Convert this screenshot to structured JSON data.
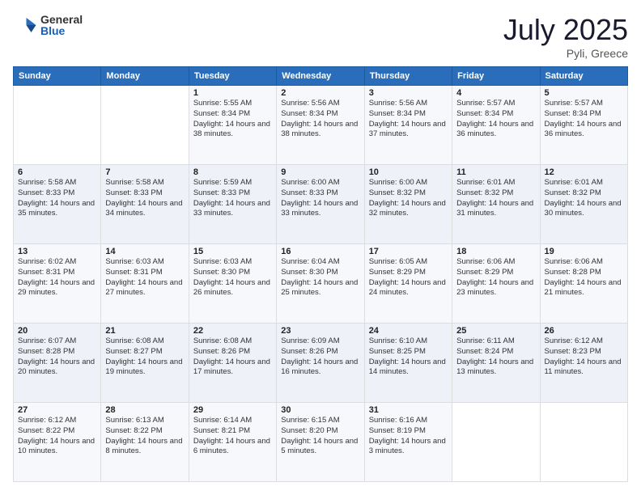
{
  "header": {
    "logo_general": "General",
    "logo_blue": "Blue",
    "title": "July 2025",
    "location": "Pyli, Greece"
  },
  "calendar": {
    "days_header": [
      "Sunday",
      "Monday",
      "Tuesday",
      "Wednesday",
      "Thursday",
      "Friday",
      "Saturday"
    ],
    "weeks": [
      [
        {
          "day": "",
          "info": ""
        },
        {
          "day": "",
          "info": ""
        },
        {
          "day": "1",
          "sunrise": "5:55 AM",
          "sunset": "8:34 PM",
          "daylight": "14 hours and 38 minutes."
        },
        {
          "day": "2",
          "sunrise": "5:56 AM",
          "sunset": "8:34 PM",
          "daylight": "14 hours and 38 minutes."
        },
        {
          "day": "3",
          "sunrise": "5:56 AM",
          "sunset": "8:34 PM",
          "daylight": "14 hours and 37 minutes."
        },
        {
          "day": "4",
          "sunrise": "5:57 AM",
          "sunset": "8:34 PM",
          "daylight": "14 hours and 36 minutes."
        },
        {
          "day": "5",
          "sunrise": "5:57 AM",
          "sunset": "8:34 PM",
          "daylight": "14 hours and 36 minutes."
        }
      ],
      [
        {
          "day": "6",
          "sunrise": "5:58 AM",
          "sunset": "8:33 PM",
          "daylight": "14 hours and 35 minutes."
        },
        {
          "day": "7",
          "sunrise": "5:58 AM",
          "sunset": "8:33 PM",
          "daylight": "14 hours and 34 minutes."
        },
        {
          "day": "8",
          "sunrise": "5:59 AM",
          "sunset": "8:33 PM",
          "daylight": "14 hours and 33 minutes."
        },
        {
          "day": "9",
          "sunrise": "6:00 AM",
          "sunset": "8:33 PM",
          "daylight": "14 hours and 33 minutes."
        },
        {
          "day": "10",
          "sunrise": "6:00 AM",
          "sunset": "8:32 PM",
          "daylight": "14 hours and 32 minutes."
        },
        {
          "day": "11",
          "sunrise": "6:01 AM",
          "sunset": "8:32 PM",
          "daylight": "14 hours and 31 minutes."
        },
        {
          "day": "12",
          "sunrise": "6:01 AM",
          "sunset": "8:32 PM",
          "daylight": "14 hours and 30 minutes."
        }
      ],
      [
        {
          "day": "13",
          "sunrise": "6:02 AM",
          "sunset": "8:31 PM",
          "daylight": "14 hours and 29 minutes."
        },
        {
          "day": "14",
          "sunrise": "6:03 AM",
          "sunset": "8:31 PM",
          "daylight": "14 hours and 27 minutes."
        },
        {
          "day": "15",
          "sunrise": "6:03 AM",
          "sunset": "8:30 PM",
          "daylight": "14 hours and 26 minutes."
        },
        {
          "day": "16",
          "sunrise": "6:04 AM",
          "sunset": "8:30 PM",
          "daylight": "14 hours and 25 minutes."
        },
        {
          "day": "17",
          "sunrise": "6:05 AM",
          "sunset": "8:29 PM",
          "daylight": "14 hours and 24 minutes."
        },
        {
          "day": "18",
          "sunrise": "6:06 AM",
          "sunset": "8:29 PM",
          "daylight": "14 hours and 23 minutes."
        },
        {
          "day": "19",
          "sunrise": "6:06 AM",
          "sunset": "8:28 PM",
          "daylight": "14 hours and 21 minutes."
        }
      ],
      [
        {
          "day": "20",
          "sunrise": "6:07 AM",
          "sunset": "8:28 PM",
          "daylight": "14 hours and 20 minutes."
        },
        {
          "day": "21",
          "sunrise": "6:08 AM",
          "sunset": "8:27 PM",
          "daylight": "14 hours and 19 minutes."
        },
        {
          "day": "22",
          "sunrise": "6:08 AM",
          "sunset": "8:26 PM",
          "daylight": "14 hours and 17 minutes."
        },
        {
          "day": "23",
          "sunrise": "6:09 AM",
          "sunset": "8:26 PM",
          "daylight": "14 hours and 16 minutes."
        },
        {
          "day": "24",
          "sunrise": "6:10 AM",
          "sunset": "8:25 PM",
          "daylight": "14 hours and 14 minutes."
        },
        {
          "day": "25",
          "sunrise": "6:11 AM",
          "sunset": "8:24 PM",
          "daylight": "14 hours and 13 minutes."
        },
        {
          "day": "26",
          "sunrise": "6:12 AM",
          "sunset": "8:23 PM",
          "daylight": "14 hours and 11 minutes."
        }
      ],
      [
        {
          "day": "27",
          "sunrise": "6:12 AM",
          "sunset": "8:22 PM",
          "daylight": "14 hours and 10 minutes."
        },
        {
          "day": "28",
          "sunrise": "6:13 AM",
          "sunset": "8:22 PM",
          "daylight": "14 hours and 8 minutes."
        },
        {
          "day": "29",
          "sunrise": "6:14 AM",
          "sunset": "8:21 PM",
          "daylight": "14 hours and 6 minutes."
        },
        {
          "day": "30",
          "sunrise": "6:15 AM",
          "sunset": "8:20 PM",
          "daylight": "14 hours and 5 minutes."
        },
        {
          "day": "31",
          "sunrise": "6:16 AM",
          "sunset": "8:19 PM",
          "daylight": "14 hours and 3 minutes."
        },
        {
          "day": "",
          "info": ""
        },
        {
          "day": "",
          "info": ""
        }
      ]
    ]
  }
}
